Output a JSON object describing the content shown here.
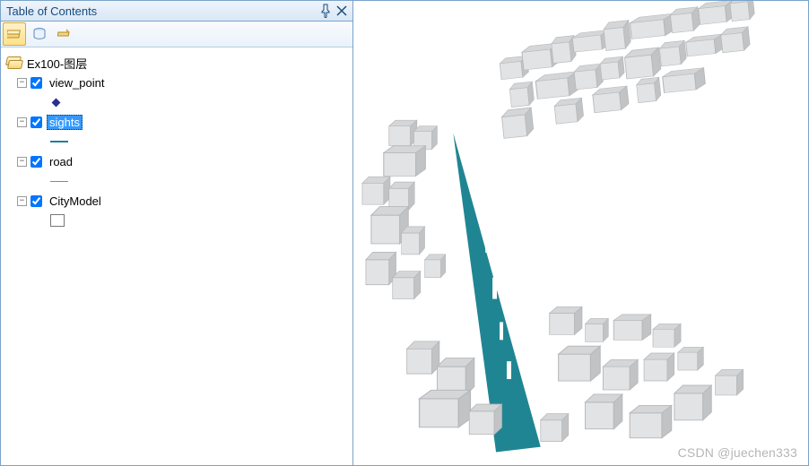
{
  "panel": {
    "title": "Table of Contents",
    "pin_tooltip": "Auto Hide",
    "close_tooltip": "Close"
  },
  "toolbar": {
    "btn_list_by_drawing_order": "List By Drawing Order",
    "btn_list_by_source": "List By Source",
    "btn_list_by_selection": "List By Selection"
  },
  "tree": {
    "group": "Ex100-图层",
    "layers": [
      {
        "name": "view_point",
        "checked": true,
        "selected": false,
        "symbol": "point"
      },
      {
        "name": "sights",
        "checked": true,
        "selected": true,
        "symbol": "line-sights"
      },
      {
        "name": "road",
        "checked": true,
        "selected": false,
        "symbol": "line-road"
      },
      {
        "name": "CityModel",
        "checked": true,
        "selected": false,
        "symbol": "poly"
      }
    ]
  },
  "map": {
    "sights_color": "#17808f",
    "building_fill": "#e2e3e4",
    "building_side": "#c1c3c5",
    "building_edge": "#b6b8ba"
  },
  "watermark": "CSDN @juechen333"
}
